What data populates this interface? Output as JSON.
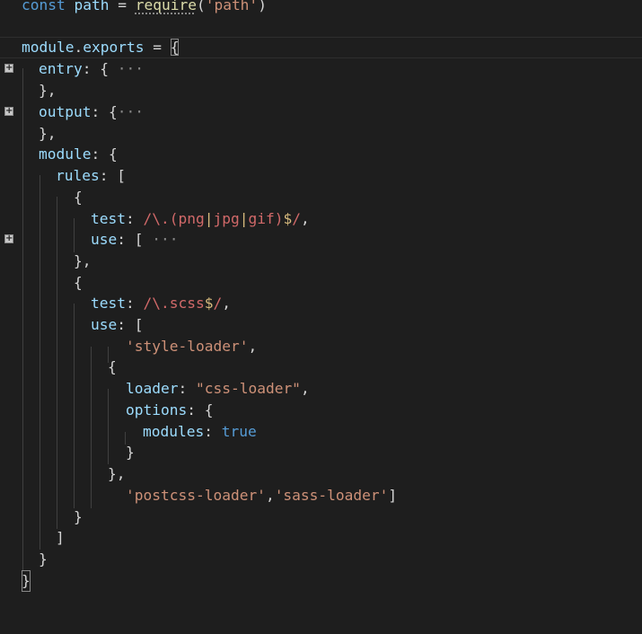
{
  "editor": {
    "line1": {
      "kw": "const",
      "name": "path",
      "eq": " = ",
      "fn": "require",
      "open": "(",
      "str": "'path'",
      "close": ")"
    },
    "line2": {
      "module": "module",
      "dot": ".",
      "exports": "exports",
      "eq": " = ",
      "brace": "{"
    },
    "line3": {
      "key": "entry",
      "colon": ": ",
      "brace": "{",
      "ellipsis": " ···"
    },
    "line4": {
      "text": "},"
    },
    "line5": {
      "key": "output",
      "colon": ": ",
      "brace": "{",
      "ellipsis": "···"
    },
    "line6": {
      "text": "},"
    },
    "line7": {
      "key": "module",
      "colon": ": ",
      "brace": "{"
    },
    "line8": {
      "key": "rules",
      "colon": ": ",
      "bracket": "["
    },
    "line9": {
      "text": "{"
    },
    "line10": {
      "key": "test",
      "colon": ": ",
      "slash1": "/",
      "esc": "\\.",
      "paren_open": "(",
      "p1": "png",
      "pipe1": "|",
      "p2": "jpg",
      "pipe2": "|",
      "p3": "gif",
      "paren_close": ")",
      "anchor": "$",
      "slash2": "/",
      "comma": ","
    },
    "line11": {
      "key": "use",
      "colon": ": ",
      "bracket": "[",
      "ellipsis": " ···"
    },
    "line12": {
      "text": "},"
    },
    "line13": {
      "text": "{"
    },
    "line14": {
      "key": "test",
      "colon": ": ",
      "slash1": "/",
      "esc": "\\.",
      "body": "scss",
      "anchor": "$",
      "slash2": "/",
      "comma": ","
    },
    "line15": {
      "key": "use",
      "colon": ": ",
      "bracket": "["
    },
    "line16": {
      "str": "'style-loader'",
      "comma": ","
    },
    "line17": {
      "text": "{"
    },
    "line18": {
      "key": "loader",
      "colon": ": ",
      "str": "\"css-loader\"",
      "comma": ","
    },
    "line19": {
      "key": "options",
      "colon": ": ",
      "brace": "{"
    },
    "line20": {
      "key": "modules",
      "colon": ": ",
      "val": "true"
    },
    "line21": {
      "text": "}"
    },
    "line22": {
      "text": "},"
    },
    "line23": {
      "str1": "'postcss-loader'",
      "comma": ",",
      "str2": "'sass-loader'",
      "close": "]"
    },
    "line24": {
      "text": "}"
    },
    "line25": {
      "text": "]"
    },
    "line26": {
      "text": "}"
    },
    "line27": {
      "text": "}"
    }
  },
  "fold_icon": {
    "name": "plus-box-icon",
    "glyph": "+"
  },
  "colors": {
    "background": "#1e1e1e",
    "keyword": "#569cd6",
    "variable": "#9cdcfe",
    "function": "#dcdcaa",
    "string": "#ce9178",
    "regex": "#d16969",
    "regex_operator": "#d7ba7d",
    "punctuation": "#d4d4d4"
  }
}
